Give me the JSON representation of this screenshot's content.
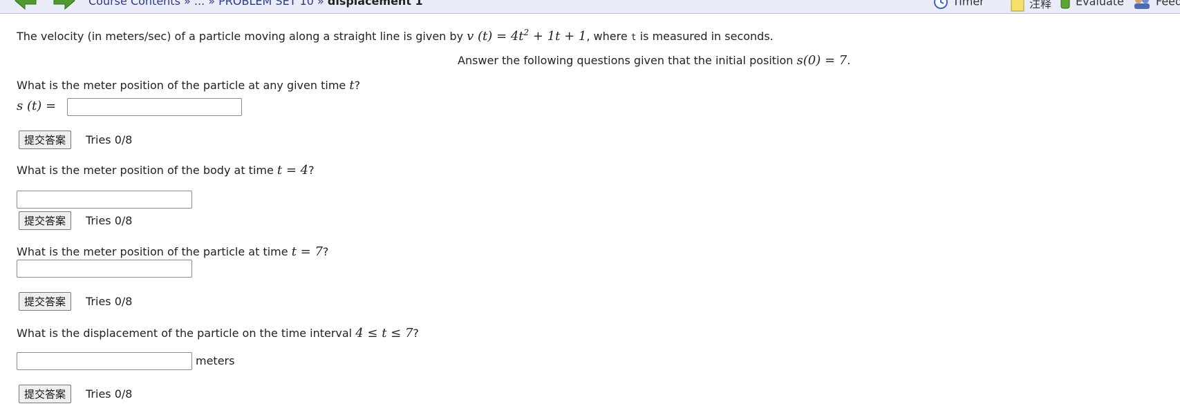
{
  "nav": {
    "breadcrumb_root": "Course Contents",
    "breadcrumb_sep1": "»",
    "breadcrumb_ellipsis": "...",
    "breadcrumb_sep2": "»",
    "breadcrumb_set": "PROBLEM SET 10",
    "breadcrumb_sep3": "»",
    "breadcrumb_current": "displacement 1",
    "timer": "Timer",
    "notes": "注释",
    "evaluate": "Evaluate",
    "feedback": "Feed"
  },
  "problem": {
    "intro_prefix": "The velocity (in meters/sec) of a particle moving along a straight line is given by",
    "velocity_expr_lhs": "v (t)",
    "velocity_expr_rhs": "= 4t",
    "velocity_expr_exp": "2",
    "velocity_expr_rest": "+ 1t + 1",
    "intro_where": ", where",
    "intro_var": "t",
    "intro_suffix": "is measured in seconds.",
    "initial_prefix": "Answer the following questions given that the initial position",
    "initial_expr": "s(0) = 7",
    "initial_suffix": "."
  },
  "questions": [
    {
      "prompt": "What is the meter position of the particle at any given time",
      "math": "t",
      "end": "?",
      "answer_label": "s (t)  =",
      "value": "",
      "submit_label": "提交答案",
      "tries": "Tries 0/8"
    },
    {
      "prompt": "What is the meter position of the body at time",
      "math": "t = 4",
      "end": "?",
      "value": "",
      "submit_label": "提交答案",
      "tries": "Tries 0/8"
    },
    {
      "prompt": "What is the meter position of the particle at time",
      "math": "t = 7",
      "end": "?",
      "value": "",
      "submit_label": "提交答案",
      "tries": "Tries 0/8"
    },
    {
      "prompt": "What is the displacement of the particle on the time interval",
      "math": "4 ≤ t ≤ 7",
      "end": "?",
      "value": "",
      "unit": "meters",
      "submit_label": "提交答案",
      "tries": "Tries 0/8"
    }
  ]
}
